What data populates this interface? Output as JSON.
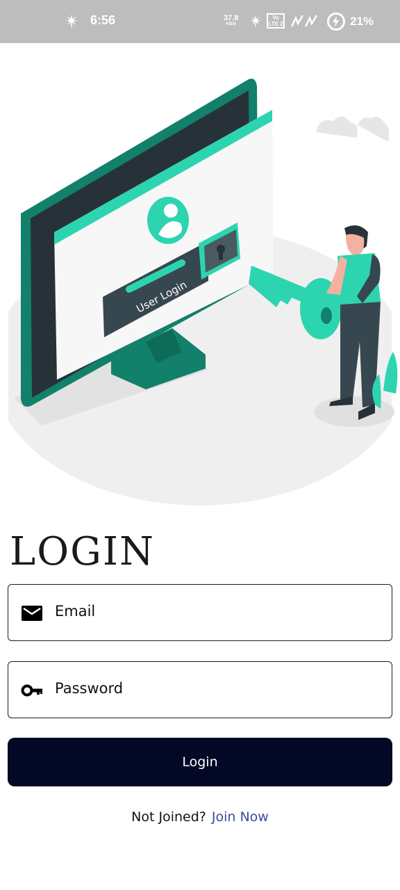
{
  "status_bar": {
    "time": "6:56",
    "network_speed": "37.8",
    "network_speed_unit": "KB/S",
    "volte_label": "Vo LTE 2",
    "battery_percent": "21%",
    "icons": [
      "cannabis-leaf-icon",
      "volte-icon",
      "signal-icon",
      "battery-charging-icon"
    ]
  },
  "illustration": {
    "screen_text": "User Login"
  },
  "page": {
    "title": "LOGIN"
  },
  "form": {
    "email_placeholder": "Email",
    "email_icon": "mail-icon",
    "password_placeholder": "Password",
    "password_icon": "key-icon",
    "submit_label": "Login"
  },
  "footer": {
    "question": "Not Joined?",
    "link_label": "Join Now"
  },
  "colors": {
    "accent": "#2dd4b0",
    "button": "#020826",
    "link": "#3b4aa0",
    "status_bar": "#bdbdbd"
  }
}
